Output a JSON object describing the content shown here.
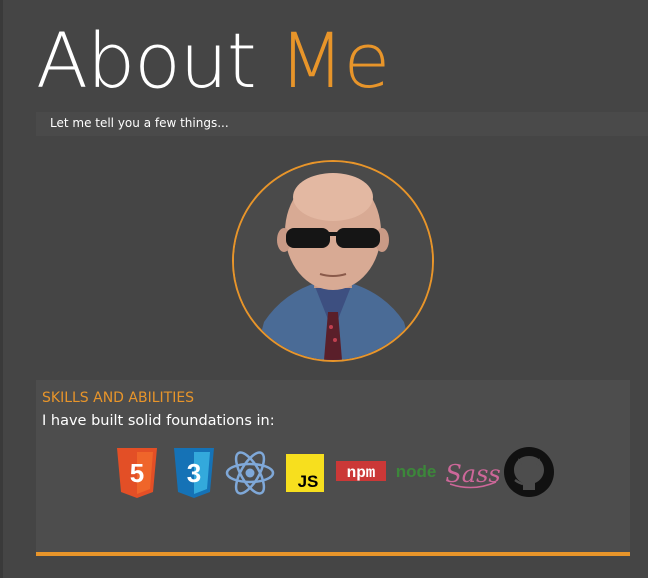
{
  "header": {
    "title_first": "About",
    "title_second": "Me",
    "subtitle": "Let me tell you a few things..."
  },
  "profile": {
    "photo_alt": "Profile photo"
  },
  "skills": {
    "heading": "SKILLS AND ABILITIES",
    "intro": "I have built solid foundations in:",
    "icons": [
      {
        "name": "html5-icon",
        "label": "5"
      },
      {
        "name": "css3-icon",
        "label": "3"
      },
      {
        "name": "react-icon"
      },
      {
        "name": "javascript-icon",
        "label": "JS"
      },
      {
        "name": "npm-icon",
        "label": "npm"
      },
      {
        "name": "nodejs-icon",
        "label": "node"
      },
      {
        "name": "sass-icon",
        "label": "Sass"
      },
      {
        "name": "github-icon"
      }
    ]
  },
  "colors": {
    "background": "#454545",
    "accent": "#e8952a",
    "panel": "#4d4d4d"
  }
}
